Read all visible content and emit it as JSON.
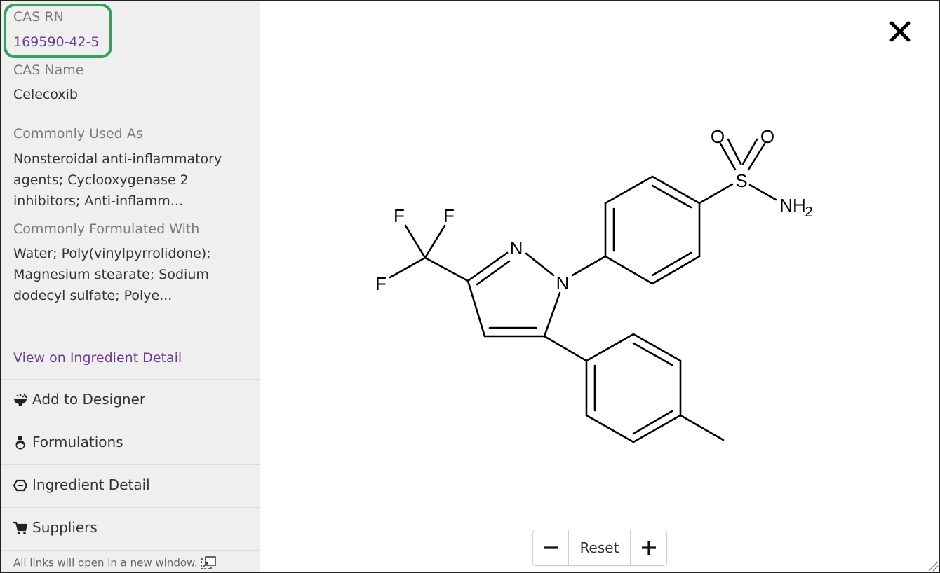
{
  "sidebar": {
    "cas_rn_label": "CAS RN",
    "cas_rn_value": "169590-42-5",
    "cas_name_label": "CAS Name",
    "cas_name_value": "Celecoxib",
    "used_as_label": "Commonly Used As",
    "used_as_line1": "Nonsteroidal anti-inflammatory",
    "used_as_line2": "agents; Cyclooxygenase 2",
    "used_as_line3": "inhibitors; Anti-inflamm...",
    "formulated_label": "Commonly Formulated With",
    "formulated_line1": "Water; Poly(vinylpyrrolidone);",
    "formulated_line2": "Magnesium stearate; Sodium",
    "formulated_line3": "dodecyl sulfate; Polye...",
    "view_link": "View on Ingredient Detail",
    "menu": [
      {
        "label": "Add to Designer",
        "icon": "mortar-icon"
      },
      {
        "label": "Formulations",
        "icon": "flask-icon"
      },
      {
        "label": "Ingredient Detail",
        "icon": "hexagon-icon"
      },
      {
        "label": "Suppliers",
        "icon": "cart-icon"
      }
    ],
    "footer_note": "All links will open in a new window."
  },
  "structure": {
    "atoms": {
      "o1": "O",
      "o2": "O",
      "s": "S",
      "nh": "NH",
      "nh_sub": "2",
      "n1": "N",
      "n2": "N",
      "f1": "F",
      "f2": "F",
      "f3": "F"
    }
  },
  "zoom": {
    "minus": "−",
    "reset": "Reset",
    "plus": "+"
  }
}
